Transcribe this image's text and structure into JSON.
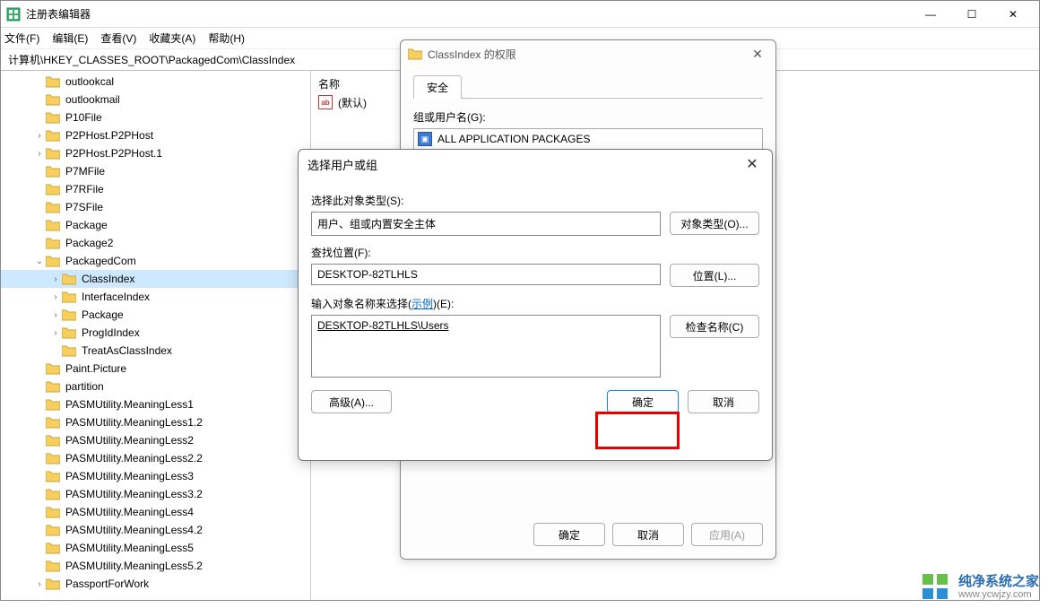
{
  "window": {
    "title": "注册表编辑器",
    "min": "—",
    "max": "☐",
    "close": "✕"
  },
  "menu": {
    "file": "文件(F)",
    "edit": "编辑(E)",
    "view": "查看(V)",
    "favorites": "收藏夹(A)",
    "help": "帮助(H)"
  },
  "address": "计算机\\HKEY_CLASSES_ROOT\\PackagedCom\\ClassIndex",
  "tree": [
    {
      "indent": 2,
      "exp": "",
      "label": "outlookcal"
    },
    {
      "indent": 2,
      "exp": "",
      "label": "outlookmail"
    },
    {
      "indent": 2,
      "exp": "",
      "label": "P10File"
    },
    {
      "indent": 2,
      "exp": ">",
      "label": "P2PHost.P2PHost"
    },
    {
      "indent": 2,
      "exp": ">",
      "label": "P2PHost.P2PHost.1"
    },
    {
      "indent": 2,
      "exp": "",
      "label": "P7MFile"
    },
    {
      "indent": 2,
      "exp": "",
      "label": "P7RFile"
    },
    {
      "indent": 2,
      "exp": "",
      "label": "P7SFile"
    },
    {
      "indent": 2,
      "exp": "",
      "label": "Package"
    },
    {
      "indent": 2,
      "exp": "",
      "label": "Package2"
    },
    {
      "indent": 2,
      "exp": "v",
      "label": "PackagedCom"
    },
    {
      "indent": 3,
      "exp": ">",
      "label": "ClassIndex",
      "selected": true
    },
    {
      "indent": 3,
      "exp": ">",
      "label": "InterfaceIndex"
    },
    {
      "indent": 3,
      "exp": ">",
      "label": "Package"
    },
    {
      "indent": 3,
      "exp": ">",
      "label": "ProgIdIndex"
    },
    {
      "indent": 3,
      "exp": "",
      "label": "TreatAsClassIndex"
    },
    {
      "indent": 2,
      "exp": "",
      "label": "Paint.Picture"
    },
    {
      "indent": 2,
      "exp": "",
      "label": "partition"
    },
    {
      "indent": 2,
      "exp": "",
      "label": "PASMUtility.MeaningLess1"
    },
    {
      "indent": 2,
      "exp": "",
      "label": "PASMUtility.MeaningLess1.2"
    },
    {
      "indent": 2,
      "exp": "",
      "label": "PASMUtility.MeaningLess2"
    },
    {
      "indent": 2,
      "exp": "",
      "label": "PASMUtility.MeaningLess2.2"
    },
    {
      "indent": 2,
      "exp": "",
      "label": "PASMUtility.MeaningLess3"
    },
    {
      "indent": 2,
      "exp": "",
      "label": "PASMUtility.MeaningLess3.2"
    },
    {
      "indent": 2,
      "exp": "",
      "label": "PASMUtility.MeaningLess4"
    },
    {
      "indent": 2,
      "exp": "",
      "label": "PASMUtility.MeaningLess4.2"
    },
    {
      "indent": 2,
      "exp": "",
      "label": "PASMUtility.MeaningLess5"
    },
    {
      "indent": 2,
      "exp": "",
      "label": "PASMUtility.MeaningLess5.2"
    },
    {
      "indent": 2,
      "exp": ">",
      "label": "PassportForWork"
    }
  ],
  "values": {
    "header_name": "名称",
    "default_row": "(默认)"
  },
  "perm_dialog": {
    "title": "ClassIndex 的权限",
    "tab_security": "安全",
    "group_label": "组或用户名(G):",
    "group_item": "ALL APPLICATION PACKAGES",
    "ok": "确定",
    "cancel": "取消",
    "apply": "应用(A)"
  },
  "select_dialog": {
    "title": "选择用户或组",
    "close": "✕",
    "object_type_label": "选择此对象类型(S):",
    "object_type_value": "用户、组或内置安全主体",
    "object_type_btn": "对象类型(O)...",
    "location_label": "查找位置(F):",
    "location_value": "DESKTOP-82TLHLS",
    "location_btn": "位置(L)...",
    "names_label_prefix": "输入对象名称来选择(",
    "names_label_link": "示例",
    "names_label_suffix": ")(E):",
    "names_value": "DESKTOP-82TLHLS\\Users",
    "check_btn": "检查名称(C)",
    "advanced_btn": "高级(A)...",
    "ok": "确定",
    "cancel": "取消"
  },
  "watermark": {
    "line1": "纯净系统之家",
    "line2": "www.ycwjzy.com"
  }
}
